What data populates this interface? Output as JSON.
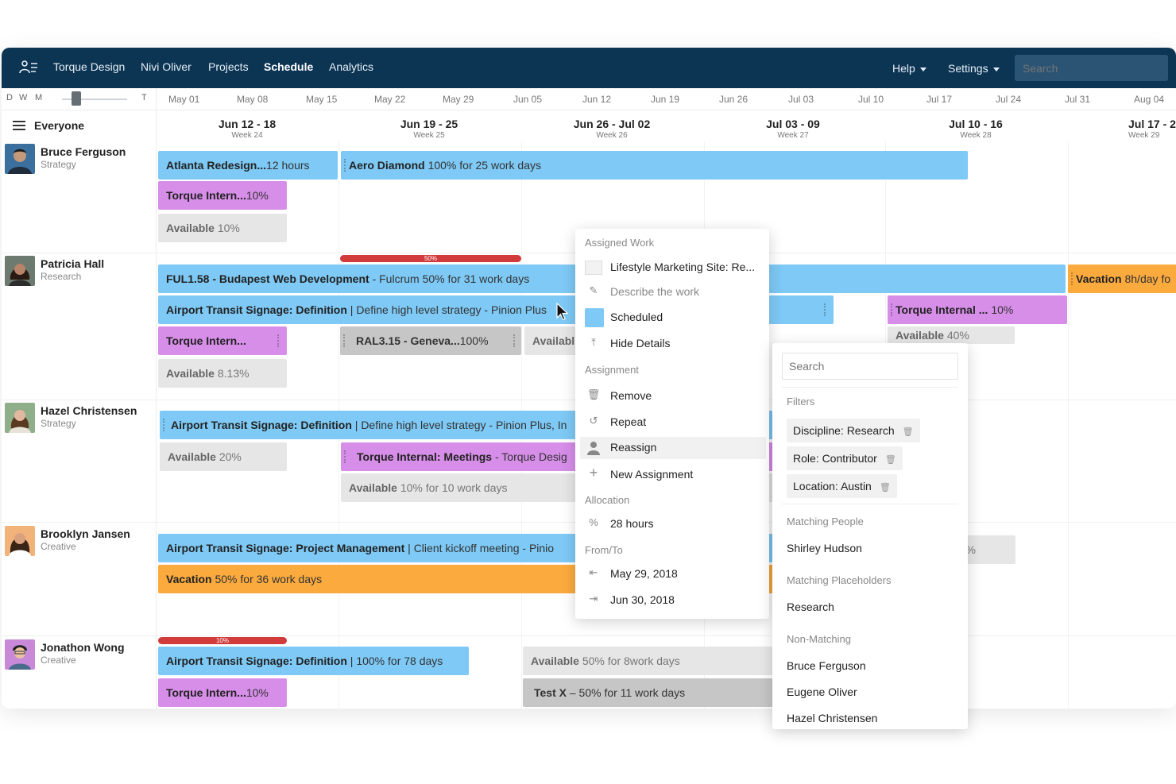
{
  "nav": {
    "items": [
      "Torque Design",
      "Nivi Oliver",
      "Projects",
      "Schedule",
      "Analytics"
    ],
    "active": "Schedule",
    "help": "Help",
    "settings": "Settings",
    "search_placeholder": "Search",
    "logo_icon": "people-icon"
  },
  "zoom": {
    "d": "D",
    "w": "W",
    "m": "M",
    "t": "T"
  },
  "months": [
    "May 01",
    "May 08",
    "May 15",
    "May 22",
    "May 29",
    "Jun 05",
    "Jun 12",
    "Jun 19",
    "Jun 26",
    "Jul 03",
    "Jul 10",
    "Jul 17",
    "Jul 24",
    "Jul 31",
    "Aug 04"
  ],
  "filter_label": "Everyone",
  "weeks": [
    {
      "range": "Jun 12 - 18",
      "week": "Week 24"
    },
    {
      "range": "Jun 19 - 25",
      "week": "Week 25"
    },
    {
      "range": "Jun 26 - Jul 02",
      "week": "Week 26"
    },
    {
      "range": "Jul 03 - 09",
      "week": "Week 27"
    },
    {
      "range": "Jul 10 - 16",
      "week": "Week 28"
    },
    {
      "range": "Jul 17 - 2",
      "week": "Week 29"
    }
  ],
  "people": [
    {
      "name": "Bruce Ferguson",
      "role": "Strategy"
    },
    {
      "name": "Patricia Hall",
      "role": "Research"
    },
    {
      "name": "Hazel Christensen",
      "role": "Strategy"
    },
    {
      "name": "Brooklyn Jansen",
      "role": "Creative"
    },
    {
      "name": "Jonathon Wong",
      "role": "Creative"
    }
  ],
  "bars": {
    "b1": {
      "title": "Atlanta Redesign...",
      "sub": "12 hours"
    },
    "b2": {
      "title": "Aero Diamond",
      "sub": "100% for 25 work days"
    },
    "b3": {
      "title": "Torque Intern...",
      "sub": "10%"
    },
    "b4": {
      "title": "Available",
      "sub": "10%"
    },
    "p_red": "50%",
    "p1": {
      "title": "FUL1.58 - Budapest Web Development",
      "sub": "- Fulcrum 50% for 31 work days"
    },
    "p2": {
      "title": "Airport Transit Signage: Definition",
      "sub": "|  Define high level strategy - Pinion Plus"
    },
    "p3": {
      "title": "Torque Intern..."
    },
    "p4": {
      "title": "RAL3.15  - Geneva...",
      "sub": "100%"
    },
    "p5": {
      "title": "Availabl"
    },
    "p6": {
      "title": "Available",
      "sub": "8.13%"
    },
    "p7": {
      "title": "Vacation",
      "sub": "8h/day fo"
    },
    "p8": {
      "title": "Torque Internal ...",
      "sub": "10%"
    },
    "p9": {
      "title": "Available",
      "sub": "40%"
    },
    "h1": {
      "title": "Airport Transit Signage: Definition",
      "sub": "| Define high level strategy - Pinion Plus, In"
    },
    "h2": {
      "title": "Available",
      "sub": "20%"
    },
    "h3": {
      "title": "Torque Internal: Meetings",
      "sub": "- Torque Desig"
    },
    "h4": {
      "title": "Available",
      "sub": "10% for 10 work days"
    },
    "k1": {
      "title": "Airport Transit Signage: Project Management",
      "sub": "|  Client kickoff meeting - Pinio"
    },
    "k2": {
      "title": "Vacation",
      "sub": "50% for 36 work days"
    },
    "k3": {
      "sub": "%"
    },
    "j_red": "10%",
    "j1": {
      "title": "Airport Transit Signage: Definition",
      "sub": "| 100% for 78 days"
    },
    "j2": {
      "title": "Torque Intern...",
      "sub": "10%"
    },
    "j3": {
      "title": "Available",
      "sub": "50% for  8work days"
    },
    "j4": {
      "title": "Test X",
      "sub": "– 50% for 11 work days"
    }
  },
  "popup": {
    "sec_assigned": "Assigned Work",
    "project": "Lifestyle Marketing Site: Re...",
    "describe": "Describe the work",
    "scheduled": "Scheduled",
    "hide": "Hide Details",
    "sec_assignment": "Assignment",
    "remove": "Remove",
    "repeat": "Repeat",
    "reassign": "Reassign",
    "new_assignment": "New Assignment",
    "sec_allocation": "Allocation",
    "alloc_icon": "%",
    "hours": "28 hours",
    "sec_fromto": "From/To",
    "from": "May 29, 2018",
    "to": "Jun 30, 2018",
    "scheduled_color": "#7ec9f5"
  },
  "panel": {
    "search_placeholder": "Search",
    "sec_filters": "Filters",
    "filters": [
      "Discipline: Research",
      "Role: Contributor",
      "Location: Austin"
    ],
    "sec_matching_people": "Matching People",
    "matching_people": [
      "Shirley Hudson"
    ],
    "sec_matching_placeholders": "Matching Placeholders",
    "matching_placeholders": [
      "Research"
    ],
    "sec_non_matching": "Non-Matching",
    "non_matching": [
      "Bruce Ferguson",
      "Eugene Oliver",
      "Hazel Christensen"
    ]
  }
}
